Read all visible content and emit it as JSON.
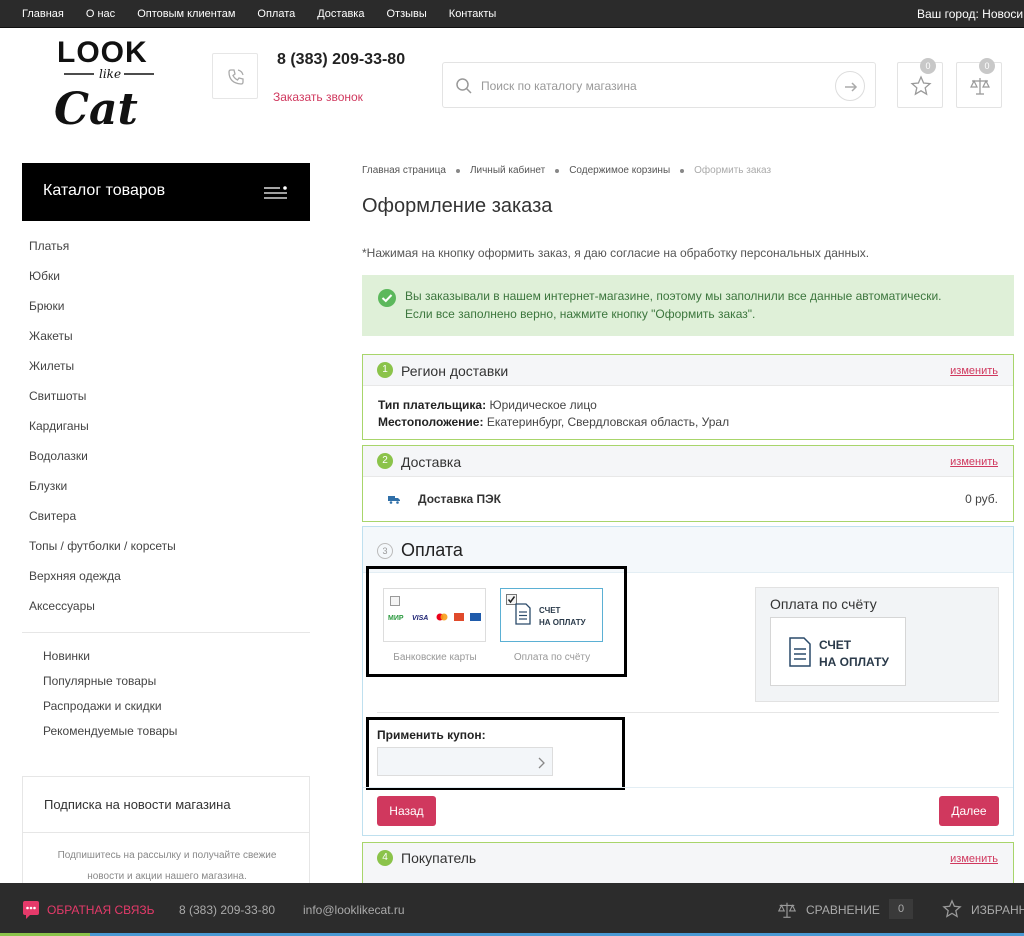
{
  "top_nav": {
    "items": [
      "Главная",
      "О нас",
      "Оптовым клиентам",
      "Оплата",
      "Доставка",
      "Отзывы",
      "Контакты"
    ],
    "city": "Ваш город: Новоси"
  },
  "header": {
    "logo_text": "LOOK like Cat",
    "phone": "8 (383) 209-33-80",
    "callback": "Заказать звонок",
    "search_placeholder": "Поиск по каталогу магазина",
    "favorites_count": "0",
    "compare_count": "0"
  },
  "sidebar": {
    "catalog_title": "Каталог товаров",
    "categories": [
      "Платья",
      "Юбки",
      "Брюки",
      "Жакеты",
      "Жилеты",
      "Свитшоты",
      "Кардиганы",
      "Водолазки",
      "Блузки",
      "Свитера",
      "Топы / футболки / корсеты",
      "Верхняя одежда",
      "Аксессуары"
    ],
    "featured": [
      "Новинки",
      "Популярные товары",
      "Распродажи и скидки",
      "Рекомендуемые товары"
    ],
    "subscribe_title": "Подписка на новости магазина",
    "subscribe_text": "Подпишитесь на рассылку и получайте свежие новости и акции нашего магазина."
  },
  "breadcrumbs": [
    "Главная страница",
    "Личный кабинет",
    "Содержимое корзины",
    "Оформить заказ"
  ],
  "page_title": "Оформление заказа",
  "consent": "*Нажимая на кнопку оформить заказ, я даю согласие на обработку персональных данных.",
  "alert": {
    "line1": "Вы заказывали в нашем интернет-магазине, поэтому мы заполнили все данные автоматически.",
    "line2": "Если все заполнено верно, нажмите кнопку \"Оформить заказ\"."
  },
  "region": {
    "step": "1",
    "title": "Регион доставки",
    "change": "изменить",
    "payer_label": "Тип плательщика:",
    "payer_value": "Юридическое лицо",
    "location_label": "Местоположение:",
    "location_value": "Екатеринбург, Свердловская область, Урал"
  },
  "delivery": {
    "step": "2",
    "title": "Доставка",
    "change": "изменить",
    "name": "Доставка ПЭК",
    "price": "0 руб."
  },
  "payment": {
    "step": "3",
    "title": "Оплата",
    "options": [
      {
        "label": "Банковские карты",
        "logos": [
          "МИР",
          "VISA",
          "MC",
          "ЮР",
          "JCB"
        ],
        "checked": false
      },
      {
        "label": "Оплата по счёту",
        "card_line1": "СЧЕТ",
        "card_line2": "НА ОПЛАТУ",
        "checked": true
      }
    ],
    "selected_title": "Оплата по счёту",
    "selected_line1": "СЧЕТ",
    "selected_line2": "НА ОПЛАТУ",
    "coupon_label": "Применить купон:",
    "coupon_value": "",
    "back": "Назад",
    "next": "Далее"
  },
  "buyer": {
    "step": "4",
    "title": "Покупатель",
    "change": "изменить"
  },
  "footer": {
    "feedback": "ОБРАТНАЯ СВЯЗЬ",
    "phone": "8 (383) 209-33-80",
    "email": "info@looklikecat.ru",
    "compare": "СРАВНЕНИЕ",
    "compare_count": "0",
    "favorites": "ИЗБРАНН"
  },
  "colors": {
    "accent": "#d0385e",
    "success": "#8bc34a",
    "topbar": "#2b2b2b",
    "alert_bg": "#dff0d8"
  }
}
